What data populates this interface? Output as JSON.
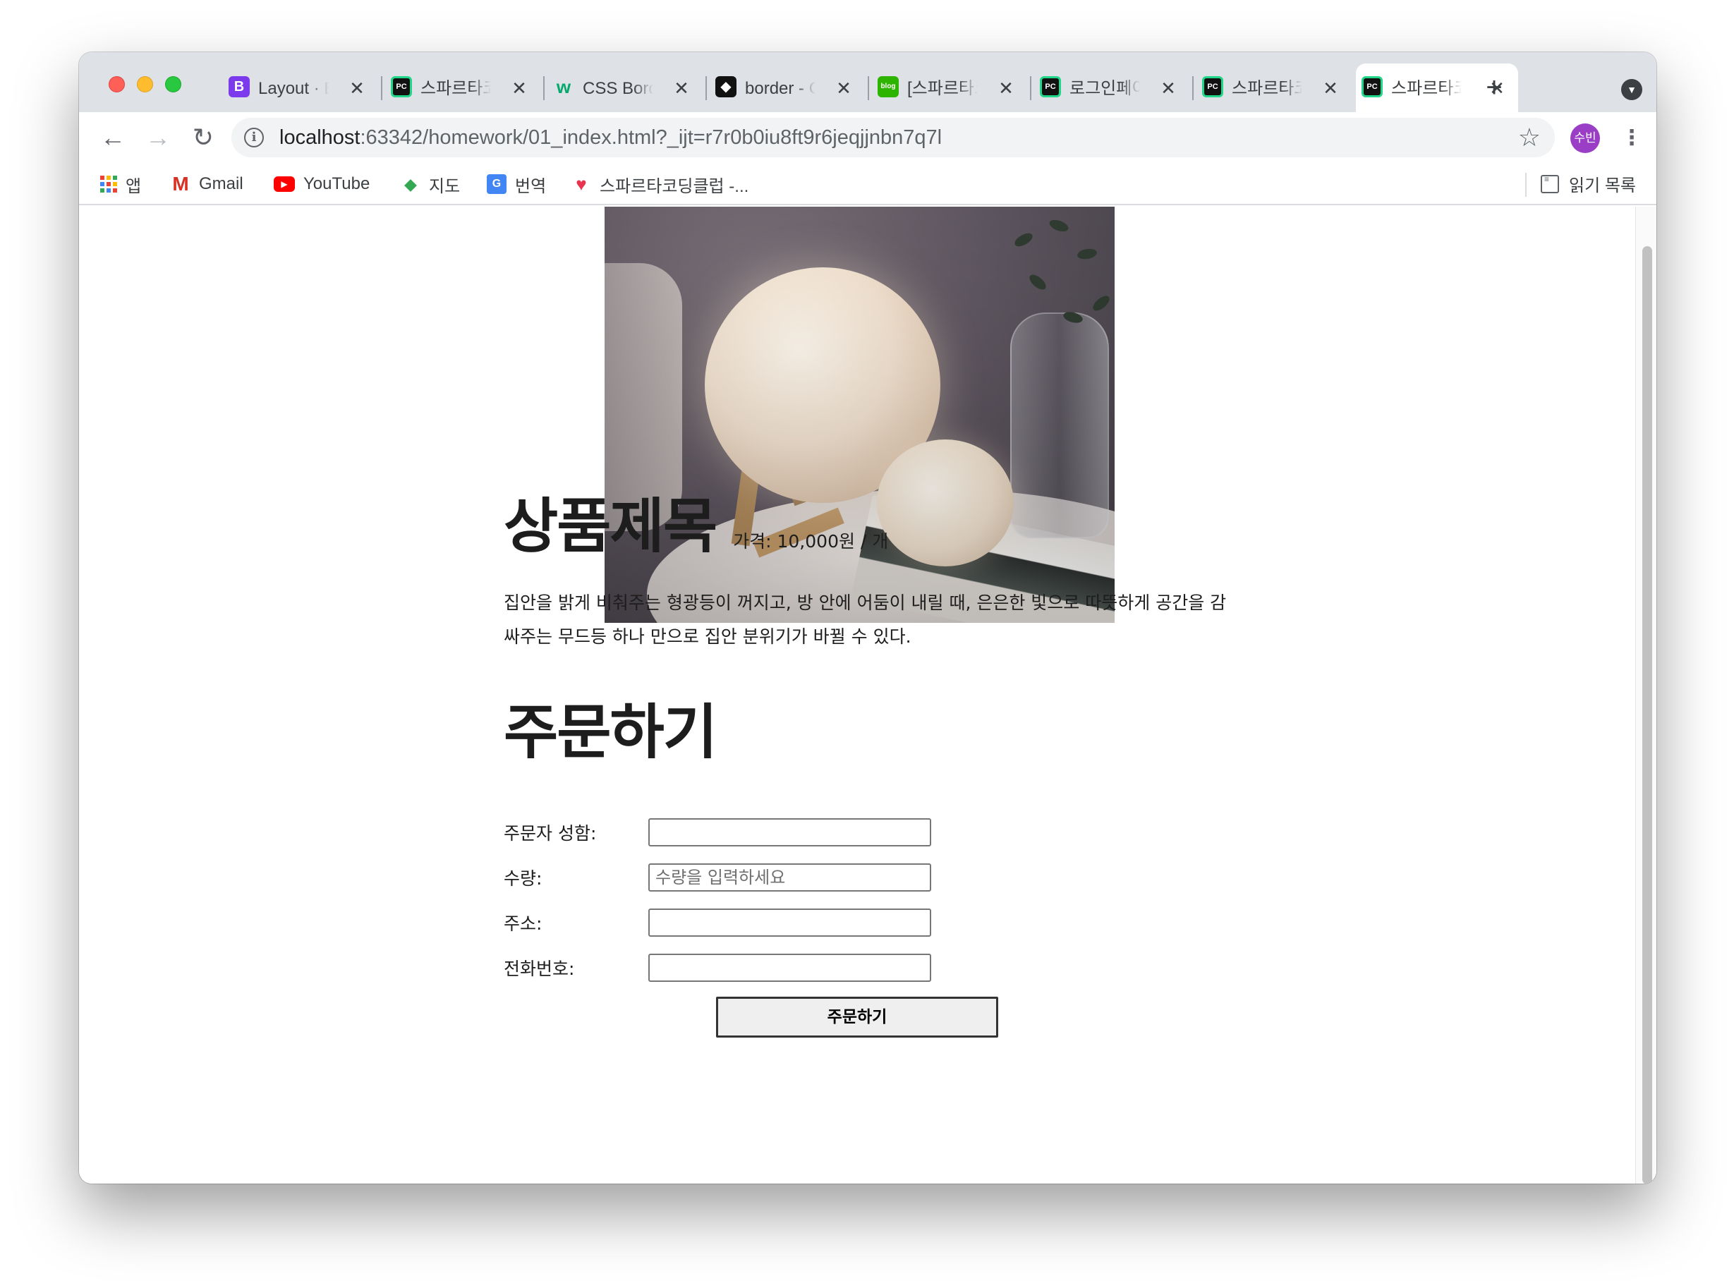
{
  "browser": {
    "tabs": [
      {
        "title": "Layout · Bootstrap",
        "favicon": "bootstrap-icon",
        "active": false
      },
      {
        "title": "스파르타코딩클럽",
        "favicon": "pycharm-icon",
        "active": false
      },
      {
        "title": "CSS Border",
        "favicon": "w3schools-icon",
        "active": false
      },
      {
        "title": "border - CSS",
        "favicon": "github-icon",
        "active": false
      },
      {
        "title": "[스파르타코딩클럽]",
        "favicon": "blog-icon",
        "active": false
      },
      {
        "title": "로그인페이지",
        "favicon": "pycharm-icon",
        "active": false
      },
      {
        "title": "스파르타코딩클럽",
        "favicon": "pycharm-icon",
        "active": false
      },
      {
        "title": "스파르타코딩클럽",
        "favicon": "pycharm-icon",
        "active": true
      }
    ],
    "close_glyph": "✕",
    "new_tab_glyph": "+",
    "url_host": "localhost",
    "url_path": ":63342/homework/01_index.html?_ijt=r7r0b0iu8ft9r6jeqjjnbn7q7l",
    "profile_initials": "수빈",
    "bookmarks": {
      "apps": "앱",
      "gmail": "Gmail",
      "youtube": "YouTube",
      "maps": "지도",
      "translate": "번역",
      "sparta": "스파르타코딩클럽 -..."
    },
    "reading_list": "읽기 목록",
    "colors": {
      "tabbar": "#dee1e6",
      "profile": "#9b3ec6"
    }
  },
  "page": {
    "product": {
      "image_alt": "moon lamp",
      "title": "상품제목",
      "price": "가격: 10,000원 / 개",
      "description": "집안을 밝게 비춰주는 형광등이 꺼지고, 방 안에 어둠이 내릴 때, 은은한 빛으로 따뜻하게 공간을 감싸주는 무드등 하나 만으로 집안 분위기가 바뀔 수 있다."
    },
    "order": {
      "title": "주문하기",
      "fields": [
        {
          "label": "주문자 성함:",
          "value": "",
          "placeholder": ""
        },
        {
          "label": "수량:",
          "value": "",
          "placeholder": "수량을 입력하세요"
        },
        {
          "label": "주소:",
          "value": "",
          "placeholder": ""
        },
        {
          "label": "전화번호:",
          "value": "",
          "placeholder": ""
        }
      ],
      "submit_label": "주문하기"
    }
  }
}
